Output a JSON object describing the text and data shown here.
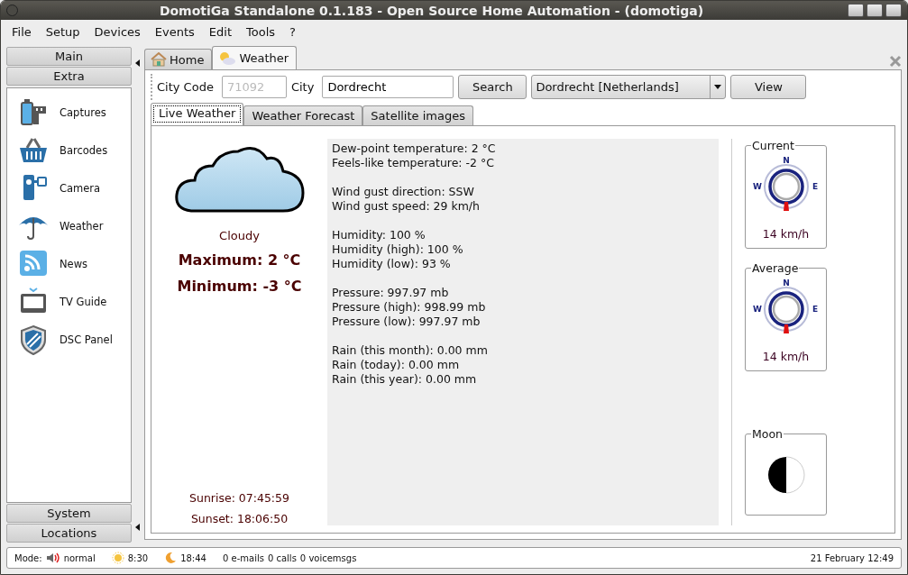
{
  "window": {
    "title": "DomotiGa Standalone 0.1.183 - Open Source Home Automation - (domotiga)"
  },
  "menu": [
    "File",
    "Setup",
    "Devices",
    "Events",
    "Edit",
    "Tools",
    "?"
  ],
  "sidebar": {
    "top_sections": [
      {
        "label": "Main"
      },
      {
        "label": "Extra"
      }
    ],
    "items": [
      {
        "label": "Captures",
        "kind": "film"
      },
      {
        "label": "Barcodes",
        "kind": "basket"
      },
      {
        "label": "Camera",
        "kind": "camera"
      },
      {
        "label": "Weather",
        "kind": "umbrella"
      },
      {
        "label": "News",
        "kind": "rss"
      },
      {
        "label": "TV Guide",
        "kind": "tv"
      },
      {
        "label": "DSC Panel",
        "kind": "shield"
      }
    ],
    "bottom_sections": [
      {
        "label": "System"
      },
      {
        "label": "Locations"
      }
    ]
  },
  "tabs": [
    {
      "label": "Home",
      "kind": "house",
      "selected": false
    },
    {
      "label": "Weather",
      "kind": "sun-cloud",
      "selected": true
    }
  ],
  "toolbar": {
    "city_code_label": "City Code",
    "city_code": {
      "value": "71092",
      "disabled": true
    },
    "city_label": "City",
    "city": {
      "value": "Dordrecht"
    },
    "search_button": "Search",
    "city_select": "Dordrecht [Netherlands]",
    "view_button": "View"
  },
  "subtabs": [
    {
      "label": "Live Weather",
      "selected": true
    },
    {
      "label": "Weather Forecast",
      "selected": false
    },
    {
      "label": "Satellite images",
      "selected": false
    }
  ],
  "summary": {
    "condition": "Cloudy",
    "maximum": "Maximum: 2 °C",
    "minimum": "Minimum: -3 °C",
    "sunrise": "Sunrise: 07:45:59",
    "sunset": "Sunset: 18:06:50"
  },
  "details": [
    [
      "Dew-point temperature: 2 °C",
      "Feels-like temperature: -2 °C"
    ],
    [
      "Wind gust direction: SSW",
      "Wind gust speed: 29 km/h"
    ],
    [
      "Humidity: 100 %",
      "Humidity (high): 100 %",
      "Humidity (low): 93 %"
    ],
    [
      "Pressure: 997.97 mb",
      "Pressure (high): 998.99 mb",
      "Pressure (low): 997.97 mb"
    ],
    [
      "Rain (this month): 0.00 mm",
      "Rain (today): 0.00 mm",
      "Rain (this year): 0.00 mm"
    ]
  ],
  "wind": [
    {
      "title": "Current",
      "speed": "14 km/h",
      "compass": [
        "N",
        "E",
        "W"
      ]
    },
    {
      "title": "Average",
      "speed": "14 km/h",
      "compass": [
        "N",
        "E",
        "W"
      ]
    }
  ],
  "moon": {
    "title": "Moon"
  },
  "status_bar": {
    "mode_label": "Mode:",
    "mode": "normal",
    "sunrise": "8:30",
    "sunset": "18:44",
    "emails": "0 e-mails",
    "calls": "0 calls",
    "voicemsgs": "0 voicemsgs",
    "datetime": "21 February 12:49"
  }
}
